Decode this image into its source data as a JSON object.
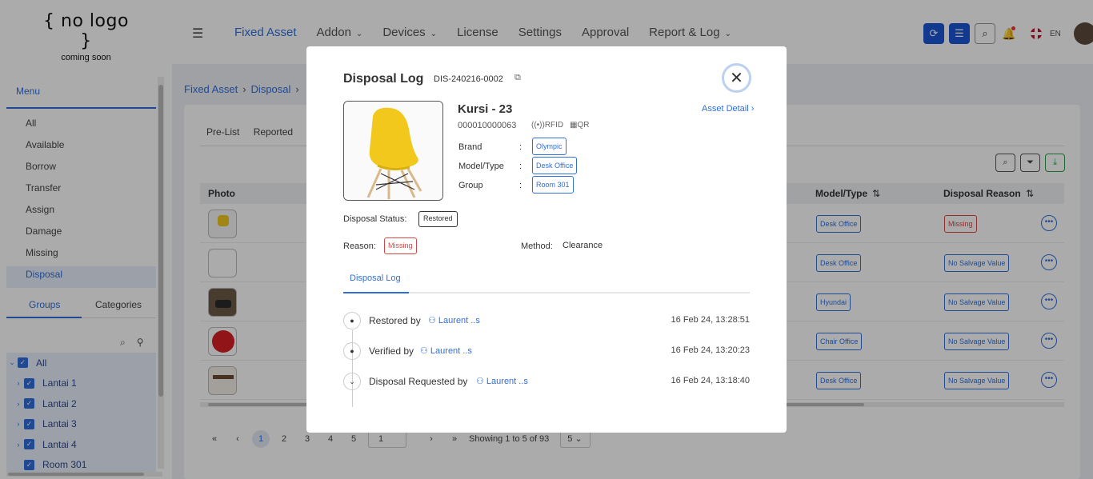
{
  "logo": {
    "line1": "{ no logo }",
    "line2": "coming soon"
  },
  "nav": {
    "items": [
      {
        "label": "Fixed Asset",
        "dropdown": false
      },
      {
        "label": "Addon",
        "dropdown": true
      },
      {
        "label": "Devices",
        "dropdown": true
      },
      {
        "label": "License",
        "dropdown": false
      },
      {
        "label": "Settings",
        "dropdown": false
      },
      {
        "label": "Approval",
        "dropdown": false
      },
      {
        "label": "Report & Log",
        "dropdown": true
      }
    ],
    "lang": "EN"
  },
  "sidebar": {
    "menu_label": "Menu",
    "items": [
      "All",
      "Available",
      "Borrow",
      "Transfer",
      "Assign",
      "Damage",
      "Missing",
      "Disposal"
    ],
    "active": "Disposal",
    "group_tabs": [
      "Groups",
      "Categories"
    ],
    "tree": [
      {
        "label": "All",
        "caret": "down"
      },
      {
        "label": "Lantai 1",
        "caret": "right"
      },
      {
        "label": "Lantai 2",
        "caret": "right"
      },
      {
        "label": "Lantai 3",
        "caret": "right"
      },
      {
        "label": "Lantai 4",
        "caret": "right"
      },
      {
        "label": "Room 301",
        "caret": ""
      }
    ]
  },
  "breadcrumb": [
    "Fixed Asset",
    "Disposal"
  ],
  "page_tabs": [
    "Pre-List",
    "Reported"
  ],
  "table": {
    "headers": {
      "photo": "Photo",
      "model": "Model/Type",
      "reason": "Disposal Reason"
    },
    "rows": [
      {
        "model": "Desk Office",
        "reason": "Missing",
        "reason_color": "#d94444"
      },
      {
        "model": "Desk Office",
        "reason": "No Salvage Value",
        "reason_color": "#2f6fdc"
      },
      {
        "model": "Hyundai",
        "reason": "No Salvage Value",
        "reason_color": "#2f6fdc"
      },
      {
        "model": "Chair Office",
        "reason": "No Salvage Value",
        "reason_color": "#2f6fdc"
      },
      {
        "model": "Desk Office",
        "reason": "No Salvage Value",
        "reason_color": "#2f6fdc"
      }
    ]
  },
  "pager": {
    "first": "«",
    "prev": "‹",
    "pages": [
      "1",
      "2",
      "3",
      "4",
      "5"
    ],
    "current": "1",
    "input": "1",
    "next": "›",
    "last": "»",
    "summary": "Showing 1 to 5 of 93",
    "per_page": "5"
  },
  "modal": {
    "title": "Disposal Log",
    "code": "DIS-240216-0002",
    "asset_name": "Kursi - 23",
    "serial": "000010000063",
    "rfid": "RFID",
    "qr": "QR",
    "asset_detail": "Asset Detail ›",
    "fields": [
      {
        "label": "Brand",
        "value": "Olympic"
      },
      {
        "label": "Model/Type",
        "value": "Desk Office"
      },
      {
        "label": "Group",
        "value": "Room 301"
      }
    ],
    "status_label": "Disposal Status:",
    "status": "Restored",
    "reason_label": "Reason:",
    "reason": "Missing",
    "method_label": "Method:",
    "method": "Clearance",
    "tab": "Disposal Log",
    "logs": [
      {
        "action": "Restored by",
        "user": "Laurent ..s",
        "date": "16 Feb 24, 13:28:51",
        "icon": "dot"
      },
      {
        "action": "Verified by",
        "user": "Laurent ..s",
        "date": "16 Feb 24, 13:20:23",
        "icon": "dot"
      },
      {
        "action": "Disposal Requested by",
        "user": "Laurent ..s",
        "date": "16 Feb 24, 13:18:40",
        "icon": "chevron"
      }
    ]
  },
  "colors": {
    "accent": "#2f6fdc",
    "primary_button": "#1a56d6",
    "danger": "#d94444"
  }
}
